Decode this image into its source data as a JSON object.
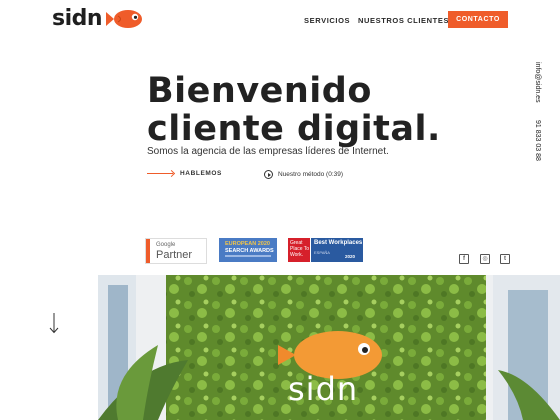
{
  "header": {
    "logo_text": "sidn",
    "nav": [
      {
        "label": "SERVICIOS"
      },
      {
        "label": "NUESTROS CLIENTES"
      }
    ],
    "contact_label": "CONTACTO"
  },
  "hero": {
    "title_line1": "Bienvenido",
    "title_line2": "cliente digital.",
    "subtitle": "Somos la agencia de las empresas líderes de Internet.",
    "cta_label": "HABLEMOS",
    "method_label": "Nuestro método (0:39)"
  },
  "contact": {
    "email": "info@sidn.es",
    "phone": "91 833 03 88"
  },
  "badges": {
    "google_top": "Google",
    "google_bottom": "Partner",
    "award_top": "EUROPEAN 2020",
    "award_bottom": "SEARCH AWARDS",
    "gptw": "Great Place To Work.",
    "best_title": "Best Workplaces",
    "best_country": "ESPAÑA",
    "best_year": "2020"
  },
  "social": [
    {
      "icon": "facebook-icon",
      "glyph": "f"
    },
    {
      "icon": "instagram-icon",
      "glyph": "◎"
    },
    {
      "icon": "twitter-icon",
      "glyph": "t"
    }
  ],
  "photo": {
    "sign_text": "sidn"
  },
  "colors": {
    "accent": "#ef5c2a",
    "moss": "#5f8a2c",
    "text": "#222222"
  }
}
